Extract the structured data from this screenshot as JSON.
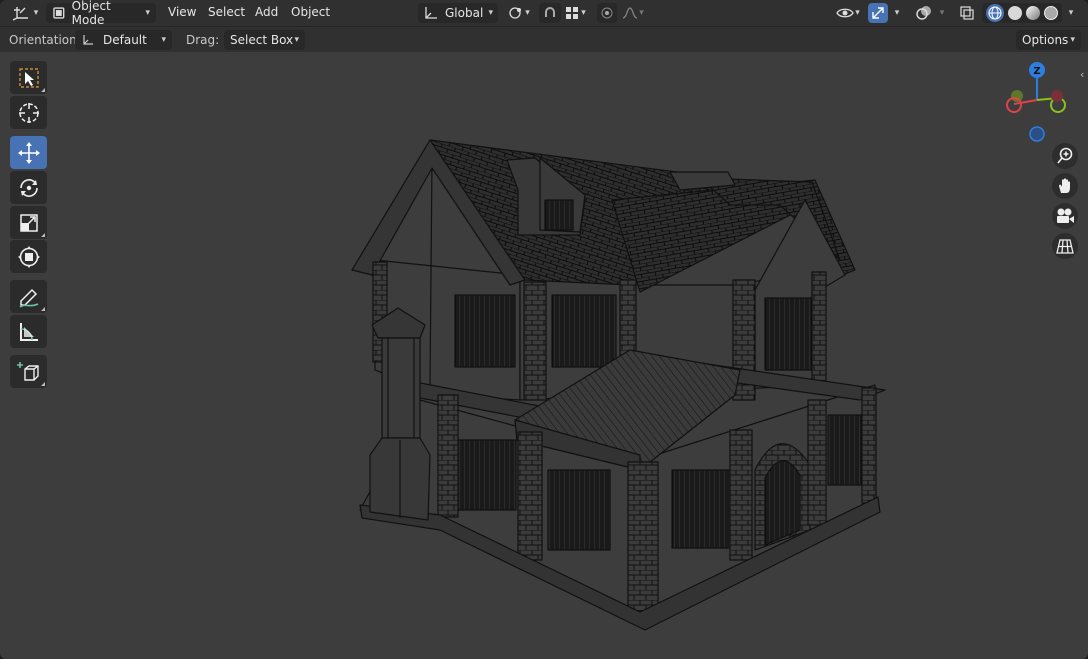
{
  "header": {
    "mode_label": "Object Mode",
    "menus": [
      "View",
      "Select",
      "Add",
      "Object"
    ],
    "transform_orientation": "Global"
  },
  "tool_settings": {
    "orientation_label": "Orientation:",
    "orientation_value": "Default",
    "drag_label": "Drag:",
    "drag_value": "Select Box",
    "options_label": "Options"
  },
  "toolbar": {
    "tools": [
      "select-box",
      "cursor",
      "move",
      "rotate",
      "scale",
      "transform",
      "annotate",
      "measure",
      "add-cube"
    ],
    "active_tool": "move"
  },
  "gizmo": {
    "axes": [
      "Z",
      "Y",
      "X"
    ],
    "colors": {
      "x": "#e0424c",
      "y": "#8ac21c",
      "z": "#2e7ee0"
    }
  },
  "navigation": [
    "zoom-icon",
    "pan-hand-icon",
    "camera-icon",
    "grid-icon"
  ],
  "shading": {
    "active": "wireframe"
  },
  "colors": {
    "accent": "#4772b3",
    "viewport_bg": "#3d3d3d",
    "header_bg": "#303030"
  }
}
